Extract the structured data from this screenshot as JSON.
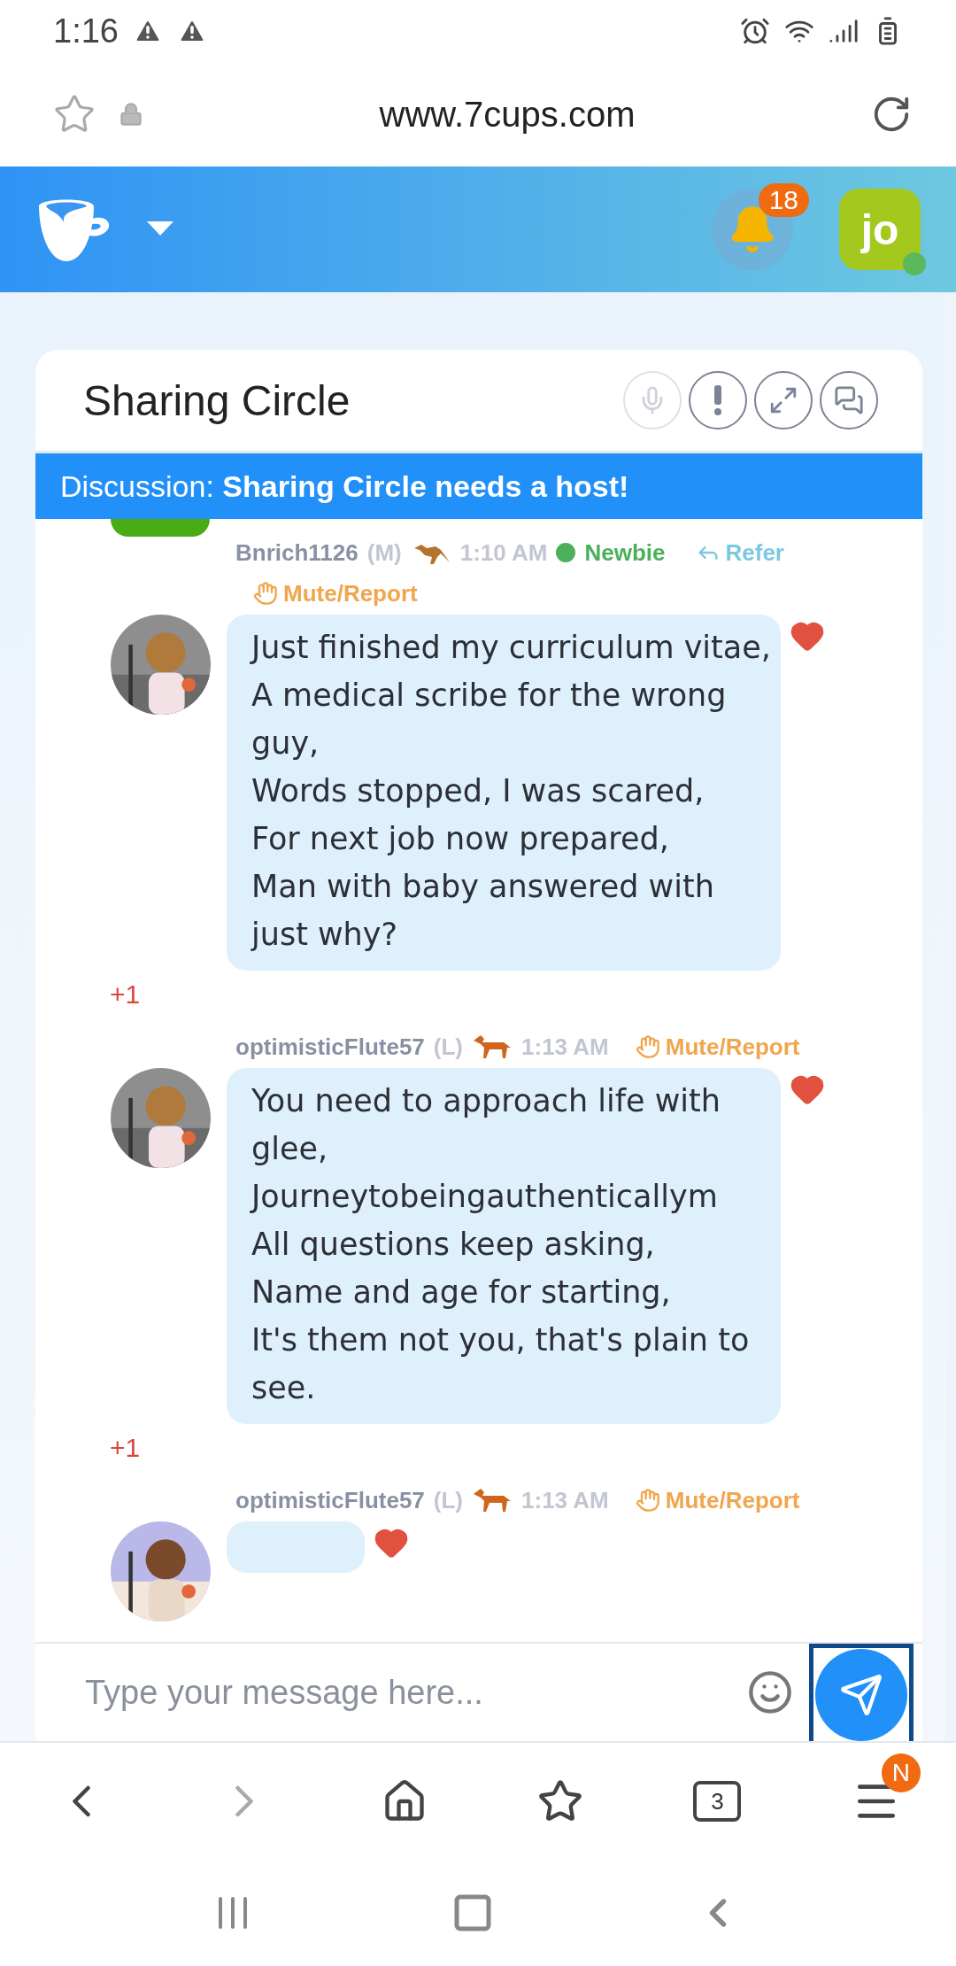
{
  "status_bar": {
    "time": "1:16"
  },
  "url_bar": {
    "url": "www.7cups.com"
  },
  "header": {
    "notification_count": "18",
    "avatar_initials": "jo",
    "online": true
  },
  "room": {
    "title": "Sharing Circle",
    "banner_label": "Discussion:",
    "banner_text": "Sharing Circle needs a host!"
  },
  "messages": [
    {
      "user": "Bnrich1126",
      "tag": "(M)",
      "kind": "kangaroo",
      "time": "1:10 AM",
      "status": "Newbie",
      "refer": "Refer",
      "mute": "Mute/Report",
      "liked": true,
      "plus": "+1",
      "lines": [
        "Just finished my curriculum vitae,",
        "A medical scribe for the wrong guy,",
        "Words stopped, I was scared,",
        "For next job now prepared,",
        "Man with baby answered with just why?"
      ]
    },
    {
      "user": "optimisticFlute57",
      "tag": "(L)",
      "kind": "horse",
      "time": "1:13 AM",
      "mute": "Mute/Report",
      "liked": true,
      "plus": "+1",
      "lines": [
        "You need to approach life with glee,",
        "Journeytobeingauthenticallym",
        "All questions keep asking,",
        "Name and age for starting,",
        "It's them not you, that's plain to see."
      ]
    },
    {
      "user": "optimisticFlute57",
      "tag": "(L)",
      "kind": "horse",
      "time": "1:13 AM",
      "mute": "Mute/Report",
      "liked": true,
      "partial": true
    }
  ],
  "composer": {
    "placeholder": "Type your message here..."
  },
  "browser_nav": {
    "tab_count": "3",
    "menu_badge": "N"
  }
}
